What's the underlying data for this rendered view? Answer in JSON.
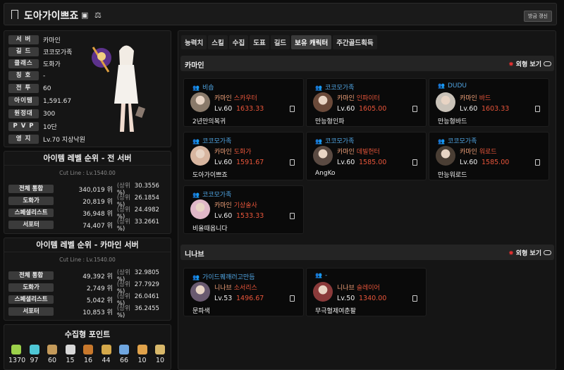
{
  "header": {
    "title": "도아가이쁘죠",
    "refresh_label": "방금 갱신"
  },
  "profile": {
    "rows": [
      {
        "label": "서 버",
        "value": "카마인"
      },
      {
        "label": "길 드",
        "value": "코코모가족"
      },
      {
        "label": "클래스",
        "value": "도화가"
      },
      {
        "label": "칭 호",
        "value": "-"
      },
      {
        "label": "전 투",
        "value": "60"
      },
      {
        "label": "아이템",
        "value": "1,591.67"
      },
      {
        "label": "원정대",
        "value": "300"
      },
      {
        "label": "P V P",
        "value": "10단"
      },
      {
        "label": "영 지",
        "value": "Lv.70 지상낙원"
      }
    ]
  },
  "rank_all": {
    "title": "아이템 레벨 순위 - 전 서버",
    "cutline": "Cut Line : Lv.1540.00",
    "rows": [
      {
        "label": "전체 통합",
        "rank": "340,019 위",
        "pct": "(상위",
        "val": "30.3556 %)"
      },
      {
        "label": "도화가",
        "rank": "20,819 위",
        "pct": "(상위",
        "val": "26.1854 %)"
      },
      {
        "label": "스페셜리스트",
        "rank": "36,948 위",
        "pct": "(상위",
        "val": "24.4982 %)"
      },
      {
        "label": "서포터",
        "rank": "74,407 위",
        "pct": "(상위",
        "val": "33.2661 %)"
      }
    ]
  },
  "rank_server": {
    "title": "아이템 레벨 순위 - 카마인 서버",
    "cutline": "Cut Line : Lv.1540.00",
    "rows": [
      {
        "label": "전체 통합",
        "rank": "49,392 위",
        "pct": "(상위",
        "val": "32.9805 %)"
      },
      {
        "label": "도화가",
        "rank": "2,749 위",
        "pct": "(상위",
        "val": "27.7929 %)"
      },
      {
        "label": "스페셜리스트",
        "rank": "5,042 위",
        "pct": "(상위",
        "val": "26.0461 %)"
      },
      {
        "label": "서포터",
        "rank": "10,853 위",
        "pct": "(상위",
        "val": "36.2455 %)"
      }
    ]
  },
  "collect": {
    "title": "수집형 포인트",
    "items": [
      {
        "icon": "mokoko-seed-icon",
        "value": "1370",
        "color": "#9bd04a"
      },
      {
        "icon": "island-heart-icon",
        "value": "97",
        "color": "#4ec7d6"
      },
      {
        "icon": "great-art-icon",
        "value": "60",
        "color": "#c49a5a"
      },
      {
        "icon": "giant-heart-icon",
        "value": "15",
        "color": "#d8d8d8"
      },
      {
        "icon": "ignea-token-icon",
        "value": "16",
        "color": "#c8782c"
      },
      {
        "icon": "adventure-book-icon",
        "value": "44",
        "color": "#d4a84a"
      },
      {
        "icon": "sea-bounty-icon",
        "value": "66",
        "color": "#6fa6e0"
      },
      {
        "icon": "world-tree-leaf-icon",
        "value": "10",
        "color": "#e0a24a"
      },
      {
        "icon": "orpheus-star-icon",
        "value": "10",
        "color": "#d8b86a"
      }
    ]
  },
  "tabs": [
    "능력치",
    "스킬",
    "수집",
    "도표",
    "길드",
    "보유 캐릭터",
    "주간골드획득"
  ],
  "servers": [
    {
      "name": "카마인",
      "look_label": "외형 보기",
      "chars": [
        {
          "guild": "비숍",
          "server": "카마인",
          "cls": "스카우터",
          "lv": "Lv.60",
          "ilvl": "1633.33",
          "name": "2년만의복귀",
          "face": "#8a7a6a"
        },
        {
          "guild": "코코모가족",
          "server": "카마인",
          "cls": "인파이터",
          "lv": "Lv.60",
          "ilvl": "1605.00",
          "name": "만능형인파",
          "face": "#6b4a3a"
        },
        {
          "guild": "DUDU",
          "server": "카마인",
          "cls": "바드",
          "lv": "Lv.60",
          "ilvl": "1603.33",
          "name": "만능형바드",
          "face": "#c9c2b8"
        },
        {
          "guild": "코코모가족",
          "server": "카마인",
          "cls": "도화가",
          "lv": "Lv.60",
          "ilvl": "1591.67",
          "name": "도아가이쁘죠",
          "face": "#d8b6a0"
        },
        {
          "guild": "코코모가족",
          "server": "카마인",
          "cls": "데빌헌터",
          "lv": "Lv.60",
          "ilvl": "1585.00",
          "name": "AngKo",
          "face": "#5a4a42"
        },
        {
          "guild": "코코모가족",
          "server": "카마인",
          "cls": "워로드",
          "lv": "Lv.60",
          "ilvl": "1585.00",
          "name": "만능워로드",
          "face": "#4a3e34"
        },
        {
          "guild": "코코모가족",
          "server": "카마인",
          "cls": "기상술사",
          "lv": "Lv.60",
          "ilvl": "1533.33",
          "name": "비올때옵니다",
          "face": "#e0b8c8"
        }
      ]
    },
    {
      "name": "니나브",
      "look_label": "외형 보기",
      "chars": [
        {
          "guild": "가이드퀘깨러고만듬",
          "server": "니나브",
          "cls": "소서리스",
          "lv": "Lv.53",
          "ilvl": "1496.67",
          "name": "문파색",
          "face": "#6a5a70"
        },
        {
          "guild": "-",
          "server": "니나브",
          "cls": "슬레이어",
          "lv": "Lv.50",
          "ilvl": "1340.00",
          "name": "무극혈제여춘팔",
          "face": "#8a3a3a"
        }
      ]
    }
  ]
}
